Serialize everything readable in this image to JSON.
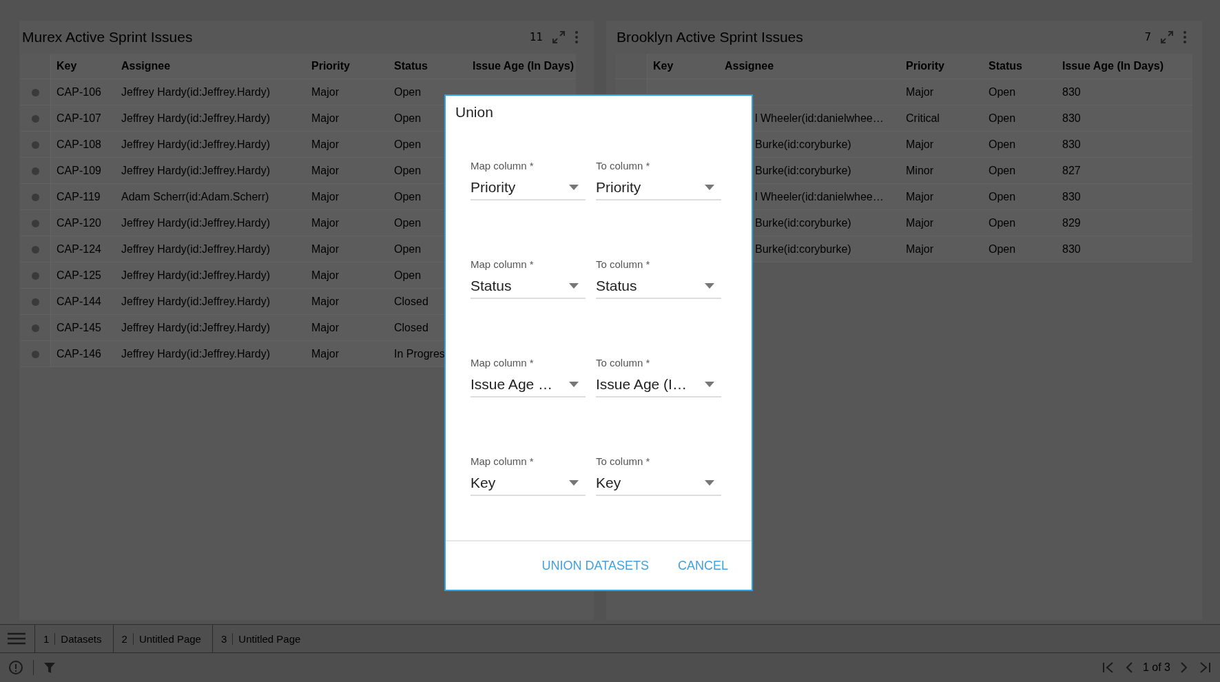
{
  "panels": [
    {
      "title": "Murex Active Sprint Issues",
      "count": "11",
      "columns": [
        "Key",
        "Assignee",
        "Priority",
        "Status",
        "Issue Age (In Days)"
      ],
      "rows": [
        {
          "key": "CAP-106",
          "assignee": "Jeffrey Hardy(id:Jeffrey.Hardy)",
          "priority": "Major",
          "status": "Open"
        },
        {
          "key": "CAP-107",
          "assignee": "Jeffrey Hardy(id:Jeffrey.Hardy)",
          "priority": "Major",
          "status": "Open"
        },
        {
          "key": "CAP-108",
          "assignee": "Jeffrey Hardy(id:Jeffrey.Hardy)",
          "priority": "Major",
          "status": "Open"
        },
        {
          "key": "CAP-109",
          "assignee": "Jeffrey Hardy(id:Jeffrey.Hardy)",
          "priority": "Major",
          "status": "Open"
        },
        {
          "key": "CAP-119",
          "assignee": "Adam Scherr(id:Adam.Scherr)",
          "priority": "Major",
          "status": "Open"
        },
        {
          "key": "CAP-120",
          "assignee": "Jeffrey Hardy(id:Jeffrey.Hardy)",
          "priority": "Major",
          "status": "Open"
        },
        {
          "key": "CAP-124",
          "assignee": "Jeffrey Hardy(id:Jeffrey.Hardy)",
          "priority": "Major",
          "status": "Open"
        },
        {
          "key": "CAP-125",
          "assignee": "Jeffrey Hardy(id:Jeffrey.Hardy)",
          "priority": "Major",
          "status": "Open"
        },
        {
          "key": "CAP-144",
          "assignee": "Jeffrey Hardy(id:Jeffrey.Hardy)",
          "priority": "Major",
          "status": "Closed"
        },
        {
          "key": "CAP-145",
          "assignee": "Jeffrey Hardy(id:Jeffrey.Hardy)",
          "priority": "Major",
          "status": "Closed"
        },
        {
          "key": "CAP-146",
          "assignee": "Jeffrey Hardy(id:Jeffrey.Hardy)",
          "priority": "Major",
          "status": "In Progres"
        }
      ]
    },
    {
      "title": "Brooklyn Active Sprint Issues",
      "count": "7",
      "columns": [
        "Key",
        "Assignee",
        "Priority",
        "Status",
        "Issue Age (In Days)"
      ],
      "rows": [
        {
          "priority": "Major",
          "status": "Open",
          "age": "830"
        },
        {
          "assignee": "l Wheeler(id:danielwhee…",
          "priority": "Critical",
          "status": "Open",
          "age": "830"
        },
        {
          "assignee": "Burke(id:coryburke)",
          "priority": "Major",
          "status": "Open",
          "age": "830"
        },
        {
          "assignee": "Burke(id:coryburke)",
          "priority": "Minor",
          "status": "Open",
          "age": "827"
        },
        {
          "assignee": "l Wheeler(id:danielwhee…",
          "priority": "Major",
          "status": "Open",
          "age": "830"
        },
        {
          "assignee": "Burke(id:coryburke)",
          "priority": "Major",
          "status": "Open",
          "age": "829"
        },
        {
          "assignee": "Burke(id:coryburke)",
          "priority": "Major",
          "status": "Open",
          "age": "830"
        }
      ]
    }
  ],
  "dialog": {
    "title": "Union",
    "mappings": [
      {
        "from_label": "Map column *",
        "from_value": "Priority",
        "to_label": "To column *",
        "to_value": "Priority"
      },
      {
        "from_label": "Map column *",
        "from_value": "Status",
        "to_label": "To column *",
        "to_value": "Status"
      },
      {
        "from_label": "Map column *",
        "from_value": "Issue Age …",
        "to_label": "To column *",
        "to_value": "Issue Age (I…"
      },
      {
        "from_label": "Map column *",
        "from_value": "Key",
        "to_label": "To column *",
        "to_value": "Key"
      }
    ],
    "buttons": [
      "UNION DATASETS",
      "CANCEL"
    ]
  },
  "tabs": [
    {
      "number": "1",
      "label": "Datasets"
    },
    {
      "number": "2",
      "label": "Untitled Page"
    },
    {
      "number": "3",
      "label": "Untitled Page"
    }
  ],
  "pagination": {
    "text": "1 of 3"
  }
}
